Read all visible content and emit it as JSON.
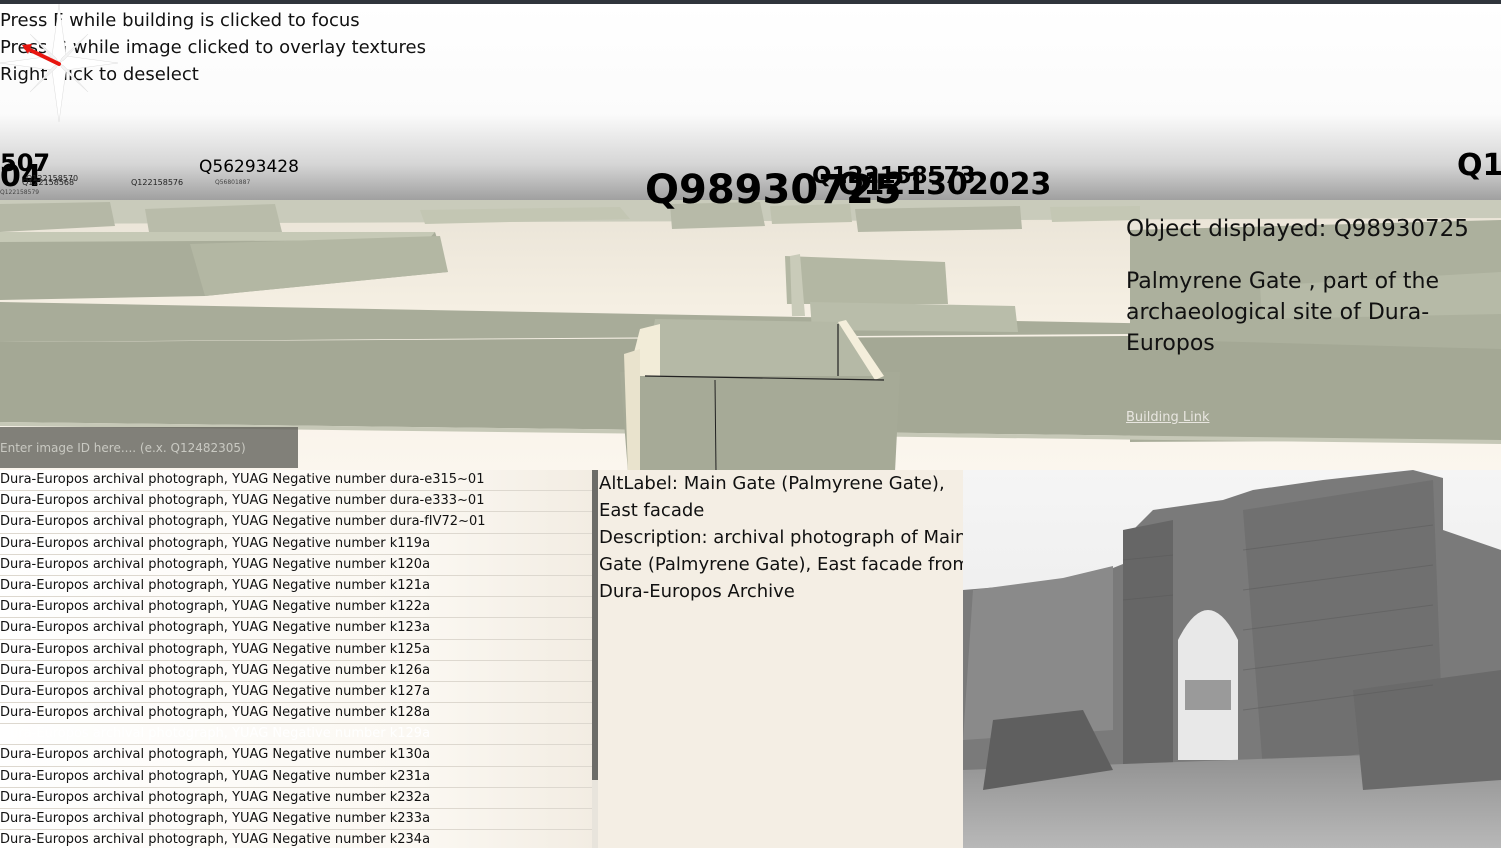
{
  "hints": [
    "Press F while building is clicked to focus",
    "Press G while image clicked to overlay textures",
    "Right click to deselect"
  ],
  "scene_labels": {
    "large_1": "Q98930725",
    "large_2": "Q121302023",
    "large_3": "Q122158573",
    "right_edge": "Q1",
    "left_edge_1": "507",
    "left_edge_2": "04",
    "medium_1": "Q56293428",
    "small_1": "Q122158570",
    "small_2": "Q122158568",
    "small_3": "Q122158576",
    "small_4": "Q56801887",
    "small_5": "Q122158579"
  },
  "compass": {
    "icon": "compass-rose-icon",
    "needle_color": "#e8150f"
  },
  "info": {
    "object_label": "Object displayed: Q98930725",
    "description": "Palmyrene Gate , part of the archaeological site of Dura-Europos",
    "link_label": "Building Link"
  },
  "search": {
    "placeholder": "Enter image ID here.... (e.x. Q12482305)",
    "value": ""
  },
  "image_list": [
    "Dura-Europos archival photograph, YUAG Negative number dura-e315~01",
    "Dura-Europos archival photograph, YUAG Negative number dura-e333~01",
    "Dura-Europos archival photograph, YUAG Negative number dura-fIV72~01",
    "Dura-Europos archival photograph, YUAG Negative number k119a",
    "Dura-Europos archival photograph, YUAG Negative number k120a",
    "Dura-Europos archival photograph, YUAG Negative number k121a",
    "Dura-Europos archival photograph, YUAG Negative number k122a",
    "Dura-Europos archival photograph, YUAG Negative number k123a",
    "Dura-Europos archival photograph, YUAG Negative number k125a",
    "Dura-Europos archival photograph, YUAG Negative number k126a",
    "Dura-Europos archival photograph, YUAG Negative number k127a",
    "Dura-Europos archival photograph, YUAG Negative number k128a",
    "Dura-Europos archival photograph, YUAG Negative number k129a",
    "Dura-Europos archival photograph, YUAG Negative number k130a",
    "Dura-Europos archival photograph, YUAG Negative number k231a",
    "Dura-Europos archival photograph, YUAG Negative number k232a",
    "Dura-Europos archival photograph, YUAG Negative number k233a",
    "Dura-Europos archival photograph, YUAG Negative number k234a"
  ],
  "selected_index": 12,
  "details": {
    "altlabel": "AltLabel: Main Gate (Palmyrene Gate), East facade",
    "description": "Description: archival photograph of Main Gate (Palmyrene Gate), East facade from Dura-Europos Archive"
  },
  "photo": {
    "subject": "archival photograph of Palmyrene Gate arch"
  }
}
